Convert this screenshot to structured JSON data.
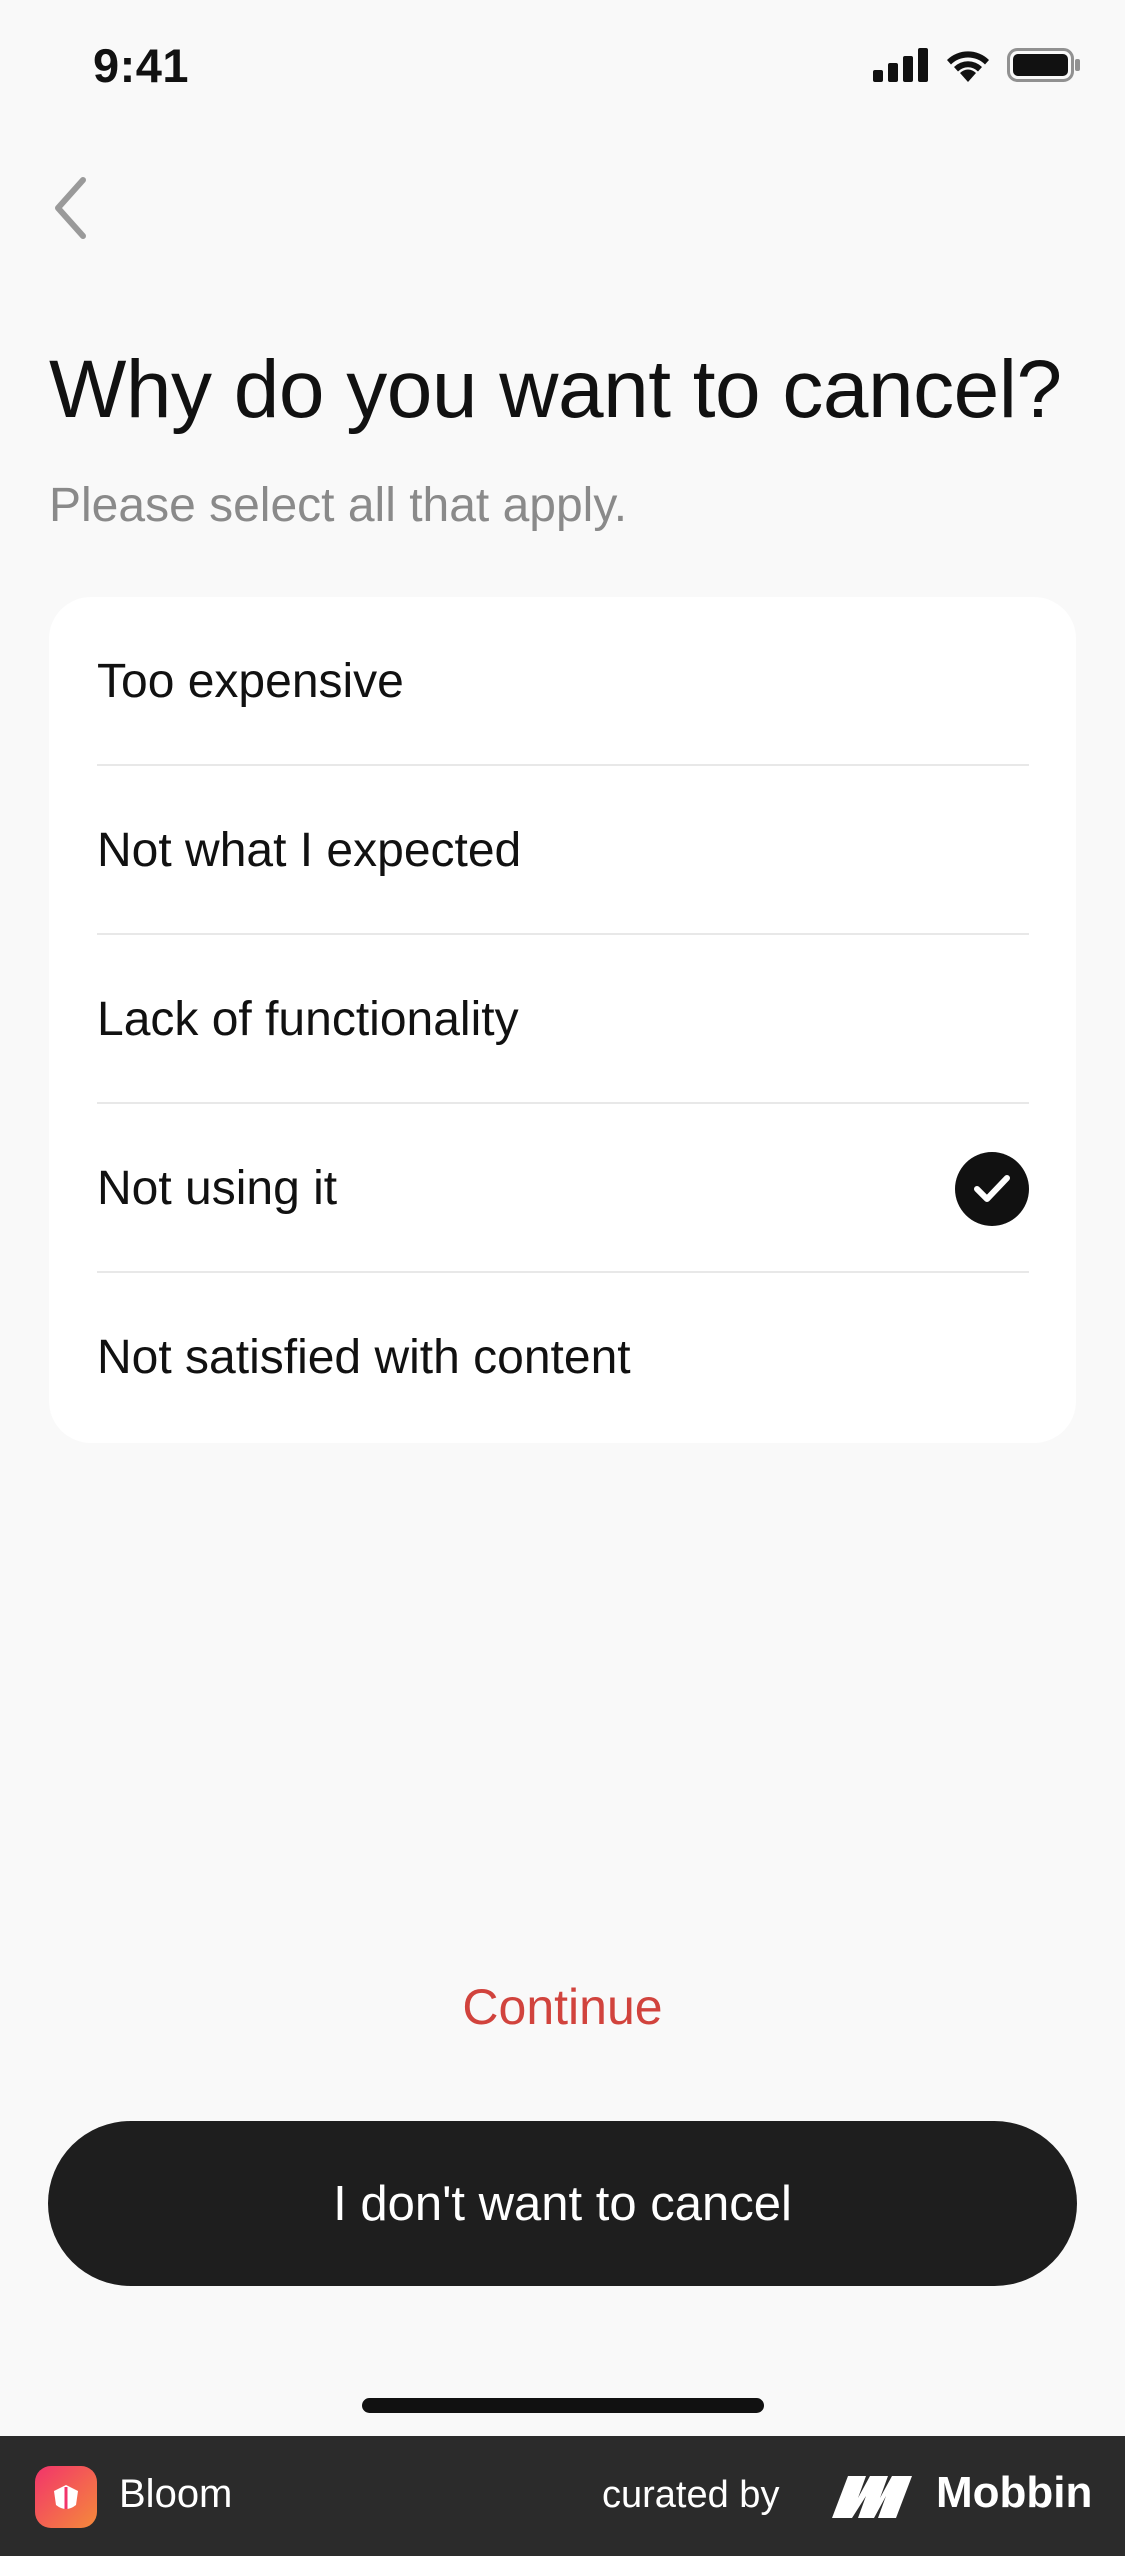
{
  "status_bar": {
    "time": "9:41"
  },
  "header": {
    "title": "Why do you want to cancel?",
    "subtitle": "Please select all that apply."
  },
  "options": [
    {
      "label": "Too expensive",
      "selected": false
    },
    {
      "label": "Not what I expected",
      "selected": false
    },
    {
      "label": "Lack of functionality",
      "selected": false
    },
    {
      "label": "Not using it",
      "selected": true
    },
    {
      "label": "Not satisfied with content",
      "selected": false
    }
  ],
  "actions": {
    "continue_label": "Continue",
    "keep_label": "I don't want to cancel"
  },
  "footer": {
    "app_name": "Bloom",
    "curated_by": "curated by",
    "brand": "Mobbin"
  },
  "colors": {
    "accent_red": "#d1433d",
    "primary_button": "#1e1e1e",
    "background": "#f9f9f9"
  },
  "icons": [
    "back-chevron-icon",
    "signal-icon",
    "wifi-icon",
    "battery-icon",
    "checkmark-icon",
    "bloom-logo-icon",
    "mobbin-logo-icon"
  ]
}
